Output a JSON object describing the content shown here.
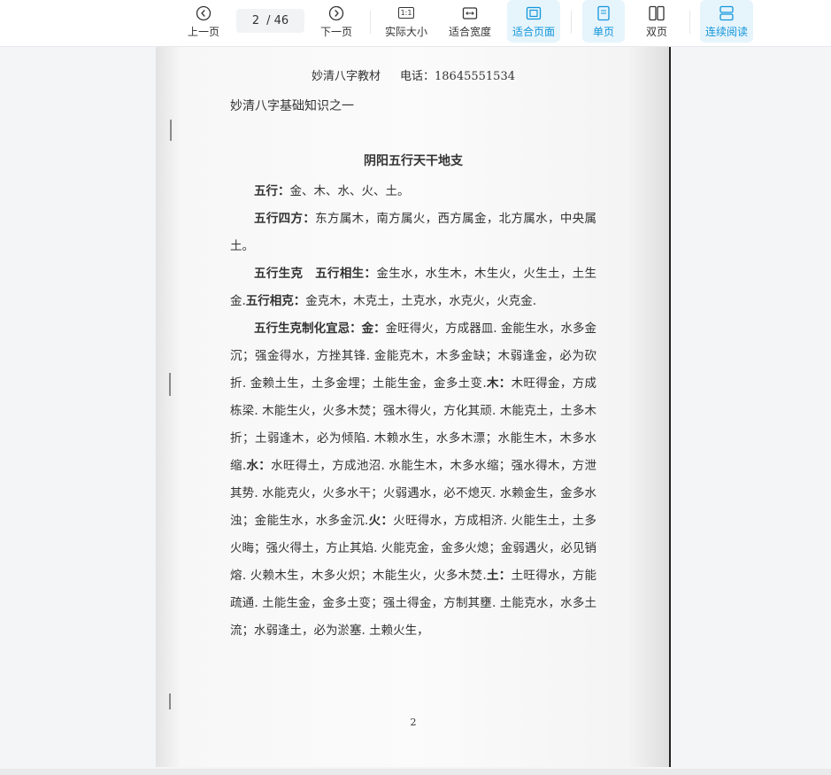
{
  "toolbar": {
    "prev_label": "上一页",
    "page_current": "2",
    "page_total": "/ 46",
    "next_label": "下一页",
    "actual_size_label": "实际大小",
    "actual_size_icon_text": "1:1",
    "fit_width_label": "适合宽度",
    "fit_page_label": "适合页面",
    "single_page_label": "单页",
    "double_page_label": "双页",
    "continuous_label": "连续阅读",
    "active_items": [
      "fit_page",
      "single_page",
      "continuous"
    ],
    "accent_color": "#1296db",
    "icons": {
      "prev": "chevron-left-circle-icon",
      "next": "chevron-right-circle-icon",
      "actual_size": "ratio-1-1-icon",
      "fit_width": "fit-width-icon",
      "fit_page": "fit-page-icon",
      "single_page": "single-page-icon",
      "double_page": "double-page-icon",
      "continuous": "continuous-scroll-icon"
    }
  },
  "document": {
    "header_left": "妙清八字教材",
    "header_right": "电话：18645551534",
    "subtitle": "妙清八字基础知识之一",
    "title": "阴阳五行天干地支",
    "p1_label": "五行：",
    "p1_text": "金、木、水、火、土。",
    "p2_label": "五行四方：",
    "p2_text": "东方属木，南方属火，西方属金，北方属水，中央属土。",
    "p3_label_a": "五行生克",
    "p3_label_b": "五行相生：",
    "p3_text_a": "金生水，水生木，木生火，火生土，土生金.",
    "p3_label_c": "五行相克：",
    "p3_text_b": "金克木，木克土，土克水，水克火，火克金.",
    "p4_label": "五行生克制化宜忌：",
    "p4_jin_label": "金：",
    "p4_jin_text": "金旺得火，方成器皿. 金能生水，水多金沉；强金得水，方挫其锋. 金能克木，木多金缺；木弱逢金，必为砍折. 金赖土生，土多金埋；土能生金，金多土变.",
    "p4_mu_label": "木：",
    "p4_mu_text": "木旺得金，方成栋梁. 木能生火，火多木焚；强木得火，方化其顽. 木能克土，土多木折；土弱逢木，必为倾陷. 木赖水生，水多木漂；水能生木，木多水缩.",
    "p4_shui_label": "水：",
    "p4_shui_text": "水旺得土，方成池沼. 水能生木，木多水缩；强水得木，方泄其势. 水能克火，火多水干；火弱遇水，必不熄灭. 水赖金生，金多水浊；金能生水，水多金沉.",
    "p4_huo_label": "火：",
    "p4_huo_text": "火旺得水，方成相济. 火能生土，土多火晦；强火得土，方止其焰. 火能克金，金多火熄；金弱遇火，必见销熔. 火赖木生，木多火炽；木能生火，火多木焚.",
    "p4_tu_label": "土：",
    "p4_tu_text": "土旺得水，方能疏通. 土能生金，金多土变；强土得金，方制其壅. 土能克水，水多土流；水弱逢土，必为淤塞. 土赖火生，",
    "page_number": "2"
  }
}
